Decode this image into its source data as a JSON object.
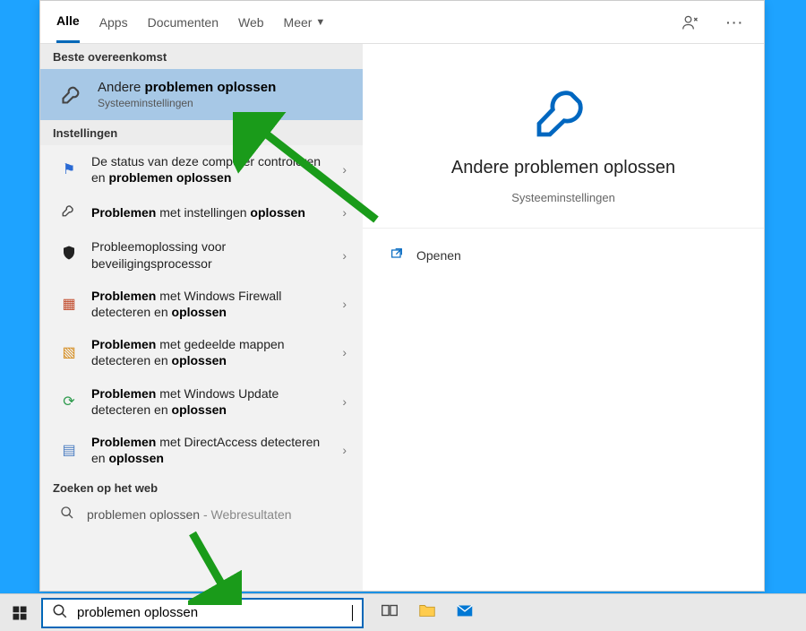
{
  "tabs": {
    "all": "Alle",
    "apps": "Apps",
    "docs": "Documenten",
    "web": "Web",
    "more": "Meer"
  },
  "sections": {
    "best": "Beste overeenkomst",
    "settings": "Instellingen",
    "web": "Zoeken op het web"
  },
  "bestmatch": {
    "title_a": "Andere ",
    "title_b": "problemen oplossen",
    "sub": "Systeeminstellingen"
  },
  "settings_list": {
    "r1a": "De status van deze computer controleren en ",
    "r1b": "problemen oplossen",
    "r2a": "Problemen",
    "r2b": " met instellingen ",
    "r2c": "oplossen",
    "r3a": "Probleemoplossing voor beveiligingsprocessor",
    "r4a": "Problemen",
    "r4b": " met Windows Firewall detecteren en ",
    "r4c": "oplossen",
    "r5a": "Problemen",
    "r5b": " met gedeelde mappen detecteren en ",
    "r5c": "oplossen",
    "r6a": "Problemen",
    "r6b": " met Windows Update detecteren en ",
    "r6c": "oplossen",
    "r7a": "Problemen",
    "r7b": " met DirectAccess detecteren en ",
    "r7c": "oplossen"
  },
  "webresult": {
    "text": "problemen oplossen",
    "suffix": " - Webresultaten"
  },
  "preview": {
    "title": "Andere problemen oplossen",
    "sub": "Systeeminstellingen",
    "open": "Openen"
  },
  "search": {
    "value": "problemen oplossen"
  }
}
